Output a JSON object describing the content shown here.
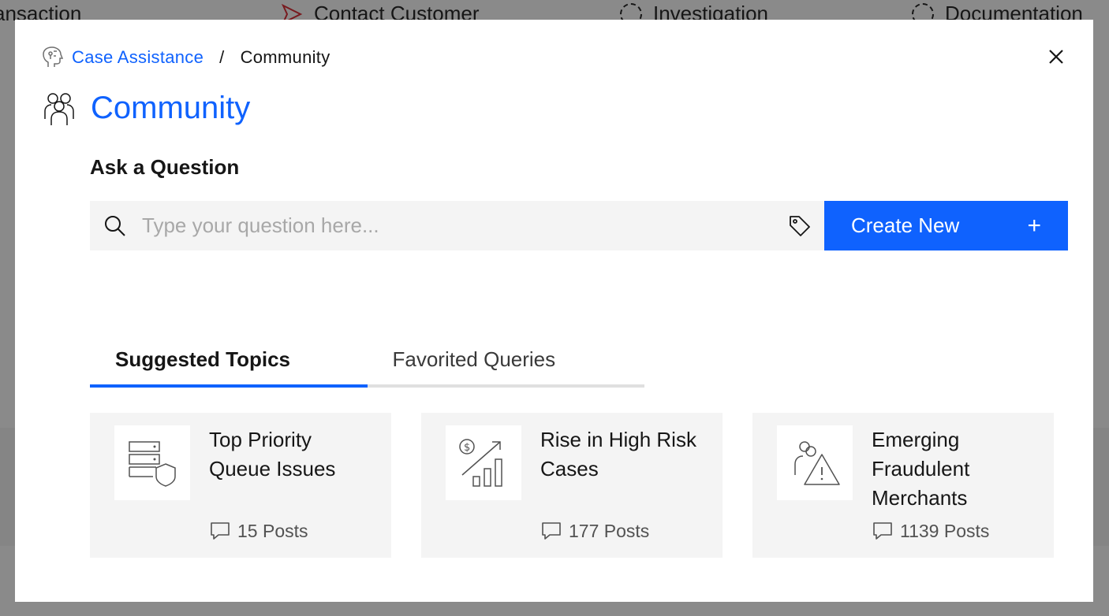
{
  "background": {
    "steps": [
      "ansaction",
      "Contact Customer",
      "Investigation",
      "Documentation"
    ]
  },
  "modal": {
    "breadcrumb": {
      "parent": "Case Assistance",
      "separator": "/",
      "current": "Community"
    },
    "title": "Community",
    "ask_label": "Ask a Question",
    "search": {
      "placeholder": "Type your question here...",
      "value": ""
    },
    "create_button": {
      "label": "Create New",
      "icon": "+"
    },
    "tabs": [
      {
        "label": "Suggested Topics",
        "active": true
      },
      {
        "label": "Favorited Queries",
        "active": false
      }
    ],
    "cards": [
      {
        "title": "Top Priority Queue Issues",
        "posts": "15 Posts",
        "icon": "server-shield-icon"
      },
      {
        "title": "Rise in High Risk Cases",
        "posts": "177 Posts",
        "icon": "growth-chart-icon"
      },
      {
        "title": "Emerging Fraudulent Merchants",
        "posts": "1139 Posts",
        "icon": "user-warning-icon"
      }
    ]
  },
  "colors": {
    "accent": "#0f62fe",
    "card_bg": "#f4f4f4",
    "input_bg": "#f4f4f4"
  }
}
